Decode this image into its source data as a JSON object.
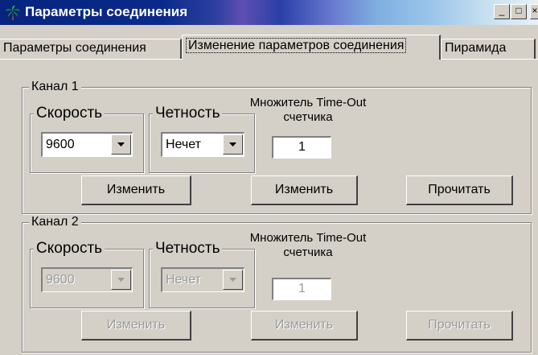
{
  "window": {
    "title": "Параметры соединения",
    "minimize_glyph": "_",
    "maximize_glyph": "□",
    "close_glyph": "×",
    "icon": "palm-tree-icon"
  },
  "tabs": [
    {
      "label": "Параметры соединения",
      "active": false
    },
    {
      "label": "Изменение параметров соединения",
      "active": true
    },
    {
      "label": "Пирамида",
      "active": false
    }
  ],
  "channels": [
    {
      "label": "Канал 1",
      "enabled": true,
      "speed": {
        "label": "Скорость",
        "value": "9600"
      },
      "parity": {
        "label": "Четность",
        "value": "Нечет"
      },
      "timeout": {
        "label_line1": "Множитель Time-Out",
        "label_line2": "счетчика",
        "value": "1"
      },
      "buttons": {
        "change1": "Изменить",
        "change2": "Изменить",
        "read": "Прочитать"
      }
    },
    {
      "label": "Канал 2",
      "enabled": false,
      "speed": {
        "label": "Скорость",
        "value": "9600"
      },
      "parity": {
        "label": "Четность",
        "value": "Нечет"
      },
      "timeout": {
        "label_line1": "Множитель Time-Out",
        "label_line2": "счетчика",
        "value": "1"
      },
      "buttons": {
        "change1": "Изменить",
        "change2": "Изменить",
        "read": "Прочитать"
      }
    }
  ],
  "colors": {
    "face": "#d4d0c8",
    "title_start": "#07247e",
    "title_end": "#e8f0f6",
    "disabled_text": "#9a9a9a"
  }
}
